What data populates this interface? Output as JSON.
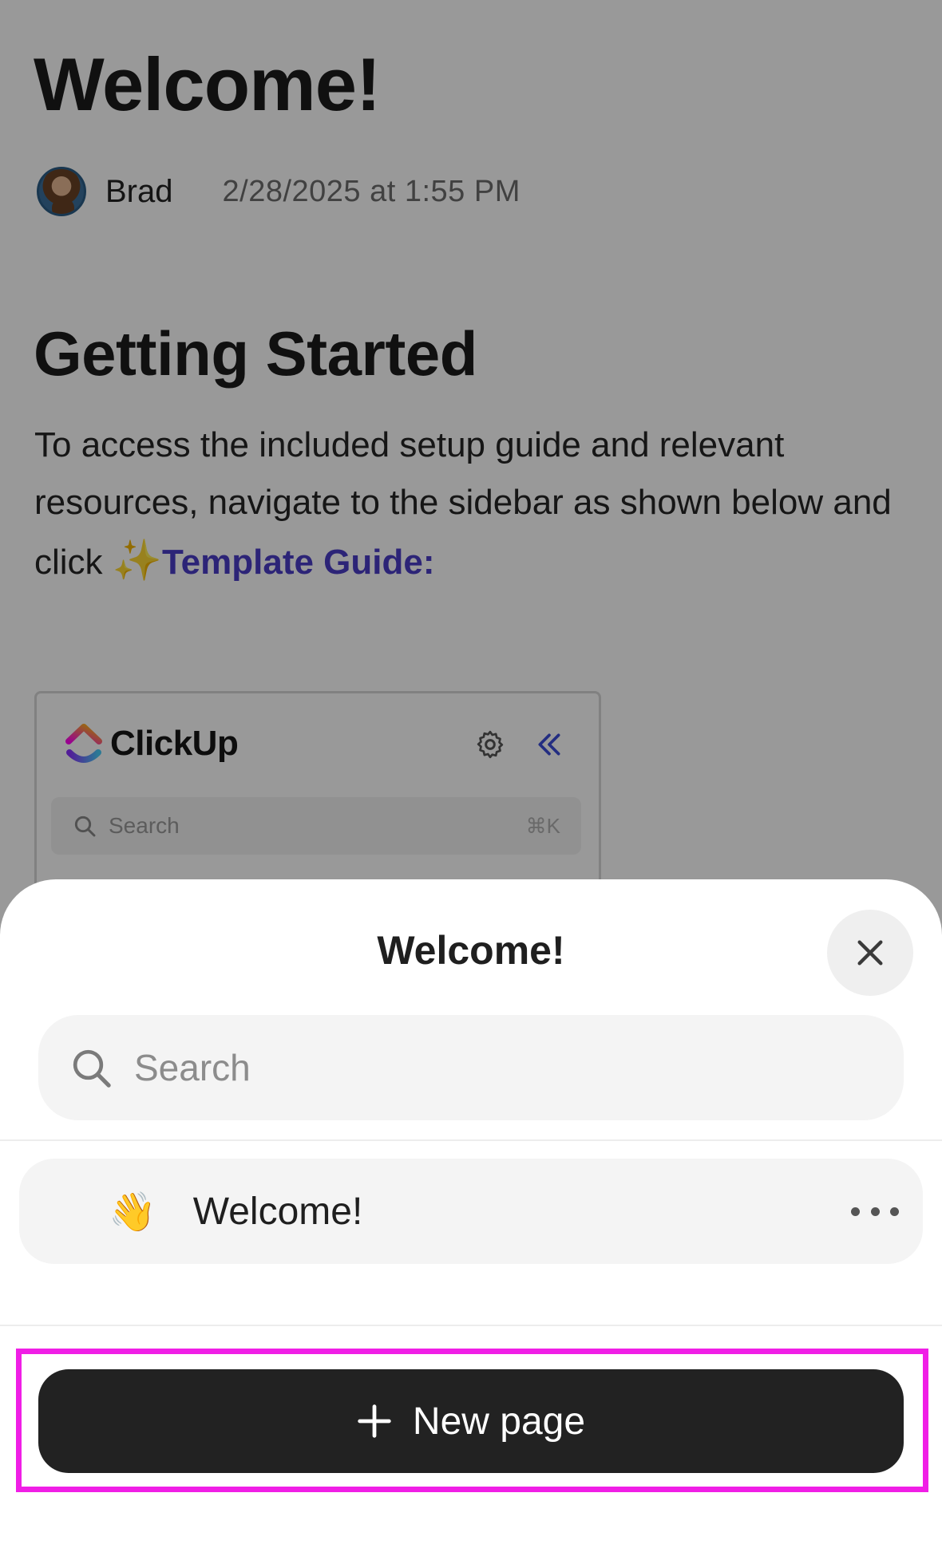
{
  "document": {
    "title": "Welcome!",
    "author": "Brad",
    "timestamp": "2/28/2025 at 1:55 PM",
    "heading": "Getting Started",
    "paragraph_text": "To access the included setup guide and relevant resources, navigate to the sidebar as shown below and click ",
    "paragraph_emoji": "✨",
    "paragraph_link": "Template Guide:",
    "preview": {
      "brand": "ClickUp",
      "search_label": "Search",
      "search_shortcut": "⌘K"
    }
  },
  "sheet": {
    "title": "Welcome!",
    "search": {
      "placeholder": "Search"
    },
    "pages": [
      {
        "emoji": "👋",
        "label": "Welcome!"
      }
    ],
    "new_page_label": "New page"
  },
  "colors": {
    "link": "#4a3cc7",
    "highlight": "#f01ee6",
    "primary_button": "#222222"
  },
  "icons": {
    "close": "close-icon",
    "search": "search-icon",
    "more": "more-horizontal-icon",
    "plus": "plus-icon",
    "settings": "gear-icon",
    "collapse": "double-chevron-left-icon"
  }
}
